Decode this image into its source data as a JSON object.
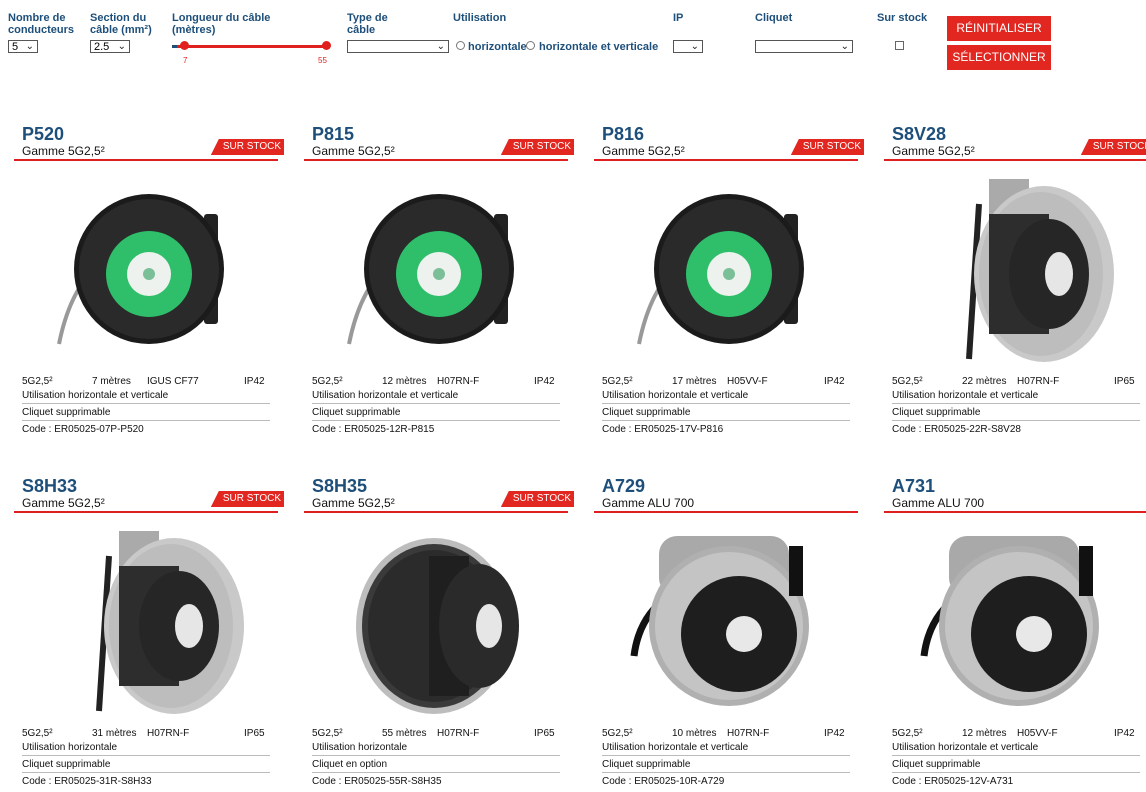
{
  "filters": {
    "conductors": {
      "label_line1": "Nombre de",
      "label_line2": "conducteurs",
      "value": "5"
    },
    "section": {
      "label_line1": "Section du",
      "label_line2": "câble (mm²)",
      "value": "2.5"
    },
    "length": {
      "label_line1": "Longueur du câble",
      "label_line2": "(mètres)",
      "min": "7",
      "max": "55"
    },
    "cable_type": {
      "label_line1": "Type de",
      "label_line2": "câble",
      "value": ""
    },
    "usage": {
      "label": "Utilisation",
      "option1": "horizontale",
      "option2": "horizontale et verticale"
    },
    "ip": {
      "label": "IP",
      "value": ""
    },
    "cliquet": {
      "label": "Cliquet",
      "value": ""
    },
    "stock": {
      "label": "Sur stock"
    },
    "reset_label": "RÉINITIALISER",
    "select_label": "SÉLECTIONNER"
  },
  "products": [
    {
      "name": "P520",
      "gamme": "Gamme 5G2,5²",
      "badge": "SUR STOCK",
      "section": "5G2,5²",
      "length": "7 mètres",
      "cable": "IGUS CF77",
      "ip": "IP42",
      "usage": "Utilisation horizontale et verticale",
      "cliquet": "Cliquet supprimable",
      "code": "Code : ER05025-07P-P520",
      "image": "reel-black-green"
    },
    {
      "name": "P815",
      "gamme": "Gamme 5G2,5²",
      "badge": "SUR STOCK",
      "section": "5G2,5²",
      "length": "12 mètres",
      "cable": "H07RN-F",
      "ip": "IP42",
      "usage": "Utilisation horizontale et verticale",
      "cliquet": "Cliquet supprimable",
      "code": "Code : ER05025-12R-P815",
      "image": "reel-black-green"
    },
    {
      "name": "P816",
      "gamme": "Gamme 5G2,5²",
      "badge": "SUR STOCK",
      "section": "5G2,5²",
      "length": "17 mètres",
      "cable": "H05VV-F",
      "ip": "IP42",
      "usage": "Utilisation horizontale et verticale",
      "cliquet": "Cliquet supprimable",
      "code": "Code : ER05025-17V-P816",
      "image": "reel-black-green"
    },
    {
      "name": "S8V28",
      "gamme": "Gamme 5G2,5²",
      "badge": "SUR STOCK",
      "section": "5G2,5²",
      "length": "22 mètres",
      "cable": "H07RN-F",
      "ip": "IP65",
      "usage": "Utilisation horizontale et verticale",
      "cliquet": "Cliquet supprimable",
      "code": "Code : ER05025-22R-S8V28",
      "image": "reel-open-steel"
    },
    {
      "name": "S8H33",
      "gamme": "Gamme 5G2,5²",
      "badge": "SUR STOCK",
      "section": "5G2,5²",
      "length": "31 mètres",
      "cable": "H07RN-F",
      "ip": "IP65",
      "usage": "Utilisation horizontale",
      "cliquet": "Cliquet supprimable",
      "code": "Code : ER05025-31R-S8H33",
      "image": "reel-open-steel"
    },
    {
      "name": "S8H35",
      "gamme": "Gamme 5G2,5²",
      "badge": "SUR STOCK",
      "section": "5G2,5²",
      "length": "55 mètres",
      "cable": "H07RN-F",
      "ip": "IP65",
      "usage": "Utilisation horizontale",
      "cliquet": "Cliquet en option",
      "code": "Code : ER05025-55R-S8H35",
      "image": "reel-open-wound"
    },
    {
      "name": "A729",
      "gamme": "Gamme ALU 700",
      "badge": "",
      "section": "5G2,5²",
      "length": "10 mètres",
      "cable": "H07RN-F",
      "ip": "IP42",
      "usage": "Utilisation horizontale et verticale",
      "cliquet": "Cliquet supprimable",
      "code": "Code : ER05025-10R-A729",
      "image": "reel-alu"
    },
    {
      "name": "A731",
      "gamme": "Gamme ALU 700",
      "badge": "",
      "section": "5G2,5²",
      "length": "12 mètres",
      "cable": "H05VV-F",
      "ip": "IP42",
      "usage": "Utilisation horizontale et verticale",
      "cliquet": "Cliquet supprimable",
      "code": "Code : ER05025-12V-A731",
      "image": "reel-alu"
    }
  ]
}
